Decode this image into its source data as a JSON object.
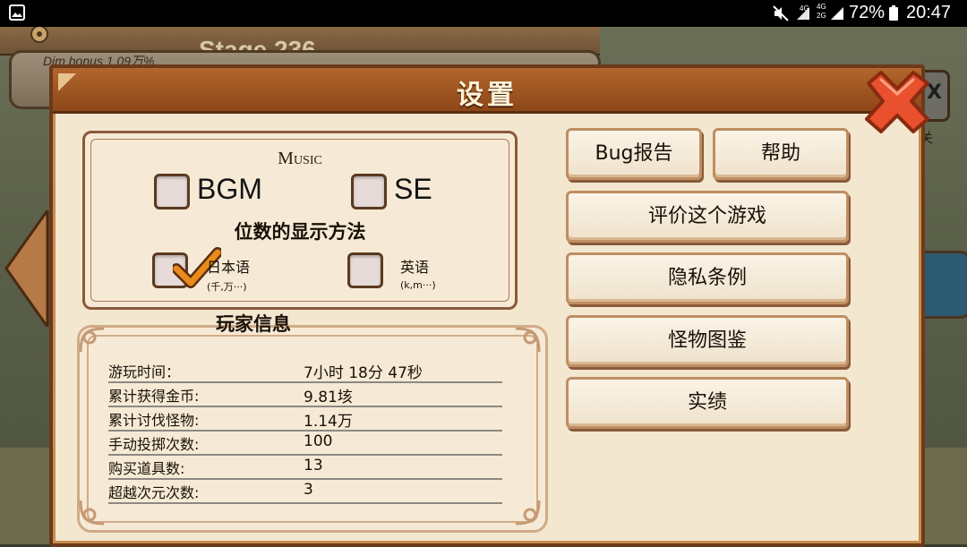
{
  "status_bar": {
    "network_top": "4G",
    "network_mid_a": "4G",
    "network_mid_b": "2G",
    "battery": "72%",
    "time": "20:47",
    "icons": [
      "gallery-icon",
      "mute-icon",
      "signal-icon",
      "battery-icon"
    ]
  },
  "background": {
    "stage_text": "Stage 236",
    "dim_bonus": "Dim bonus  1.09万%",
    "right_label": "关",
    "close_tab_text": "X"
  },
  "dialog": {
    "title": "设置",
    "settings": {
      "music_label": "Music",
      "bgm_label": "BGM",
      "bgm_checked": false,
      "se_label": "SE",
      "se_checked": false,
      "digit_heading": "位数的显示方法",
      "japanese_label": "日本语",
      "japanese_sub": "(千,万···)",
      "japanese_checked": true,
      "english_label": "英语",
      "english_sub": "(k,m···)",
      "english_checked": false
    },
    "player_info": {
      "title": "玩家信息",
      "rows": [
        {
          "label": "游玩时间：",
          "value": "7小时 18分 47秒"
        },
        {
          "label": "累计获得金币:",
          "value": "9.81垓"
        },
        {
          "label": "累计讨伐怪物:",
          "value": "1.14万"
        },
        {
          "label": "手动投掷次数:",
          "value": "100"
        },
        {
          "label": "购买道具数:",
          "value": "13"
        },
        {
          "label": "超越次元次数:",
          "value": "3"
        }
      ]
    },
    "buttons": {
      "bug_report": "Bug报告",
      "help": "帮助",
      "rate_game": "评价这个游戏",
      "privacy": "隐私条例",
      "monster_book": "怪物图鉴",
      "achievements": "实绩"
    }
  },
  "colors": {
    "header": "#9a5322",
    "panel": "#f3e7d0",
    "close_x": "#e8502e",
    "checkmark": "#e98a1a"
  }
}
